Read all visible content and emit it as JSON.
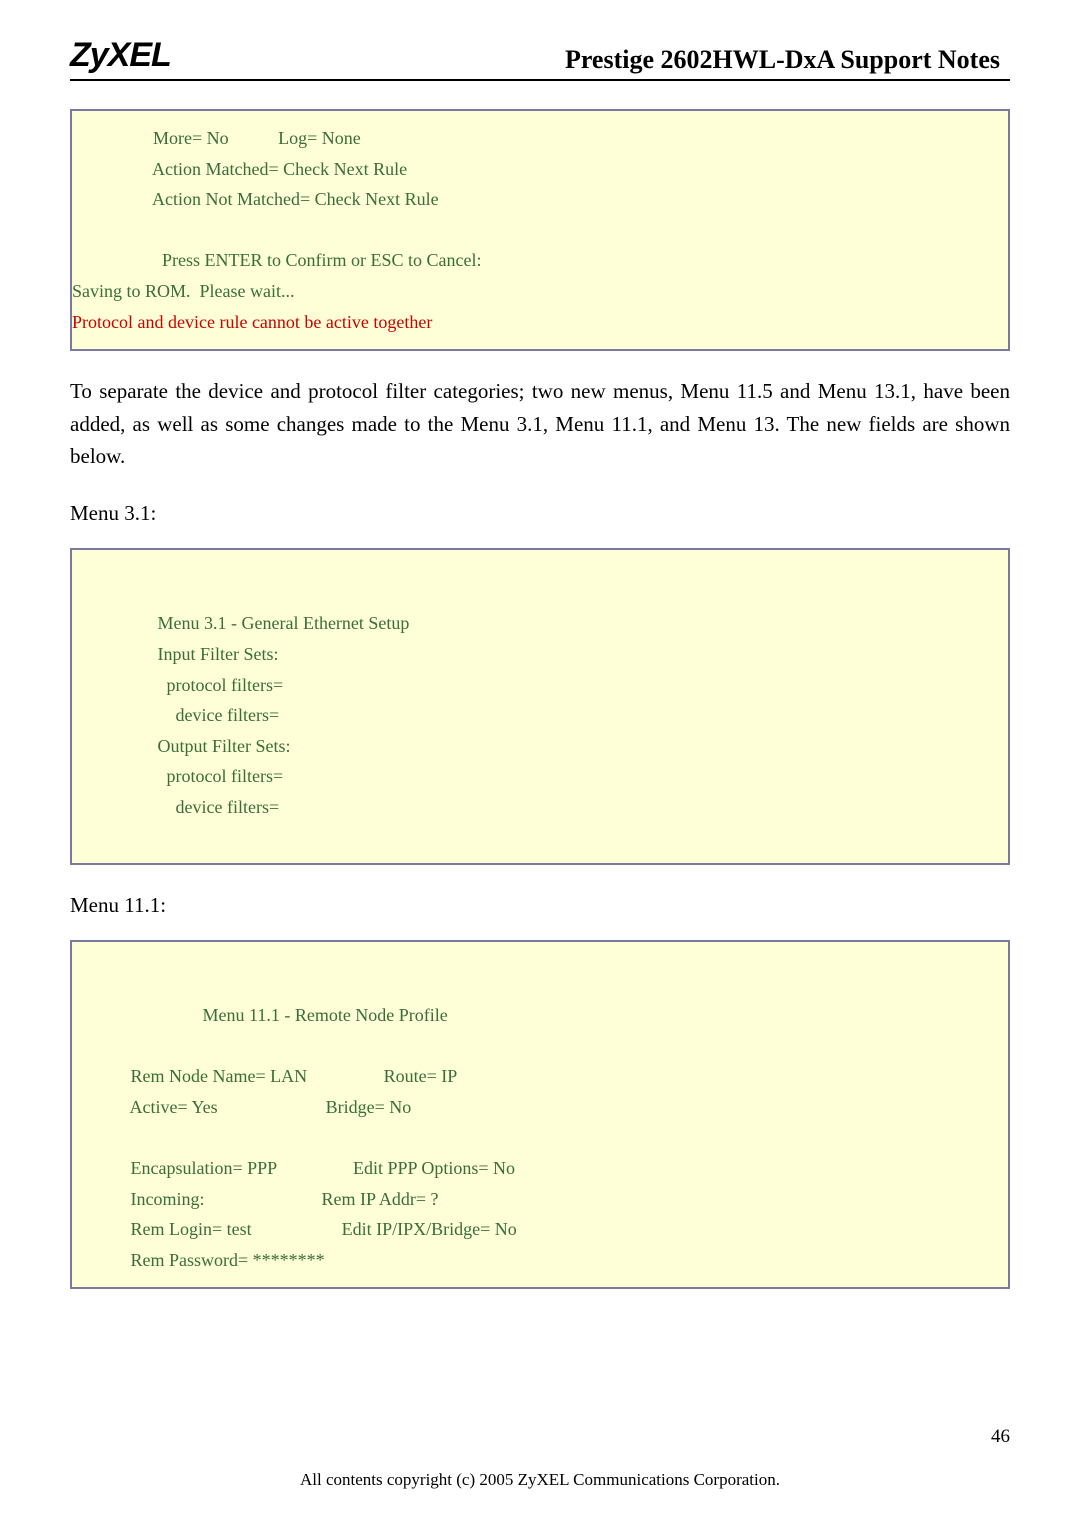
{
  "header": {
    "logo": "ZyXEL",
    "title": "Prestige 2602HWL-DxA Support Notes"
  },
  "box1": {
    "line1_a": "                  More= No           Log= None",
    "line2": "                  Action Matched= Check Next Rule",
    "line3": "                  Action Not Matched= Check Next Rule",
    "blank": "",
    "line4": "                    Press ENTER to Confirm or ESC to Cancel:",
    "line5": "Saving to ROM.  Please wait...",
    "line6": "Protocol and device rule cannot be active together"
  },
  "para1": "To separate the device and protocol filter categories; two new menus, Menu 11.5 and Menu 13.1, have been added, as well as some changes made to the Menu 3.1, Menu 11.1, and Menu 13. The new fields are shown below.",
  "label_menu31": "Menu 3.1:",
  "box2": {
    "l1": "                   Menu 3.1 - General Ethernet Setup",
    "l2": "                   Input Filter Sets:",
    "l3": "                     protocol filters=",
    "l4": "                       device filters=",
    "l5": "                   Output Filter Sets:",
    "l6": "                     protocol filters=",
    "l7": "                       device filters="
  },
  "label_menu111": "Menu 11.1:",
  "box3": {
    "l1": "                             Menu 11.1 - Remote Node Profile",
    "l2": "",
    "l3": "             Rem Node Name= LAN                 Route= IP",
    "l4": "             Active= Yes                        Bridge= No",
    "l5": "",
    "l6": "             Encapsulation= PPP                 Edit PPP Options= No",
    "l7": "             Incoming:                          Rem IP Addr= ?",
    "l8": "             Rem Login= test                    Edit IP/IPX/Bridge= No",
    "l9": "             Rem Password= ********"
  },
  "page_number": "46",
  "copyright": "All contents copyright (c) 2005 ZyXEL Communications Corporation."
}
